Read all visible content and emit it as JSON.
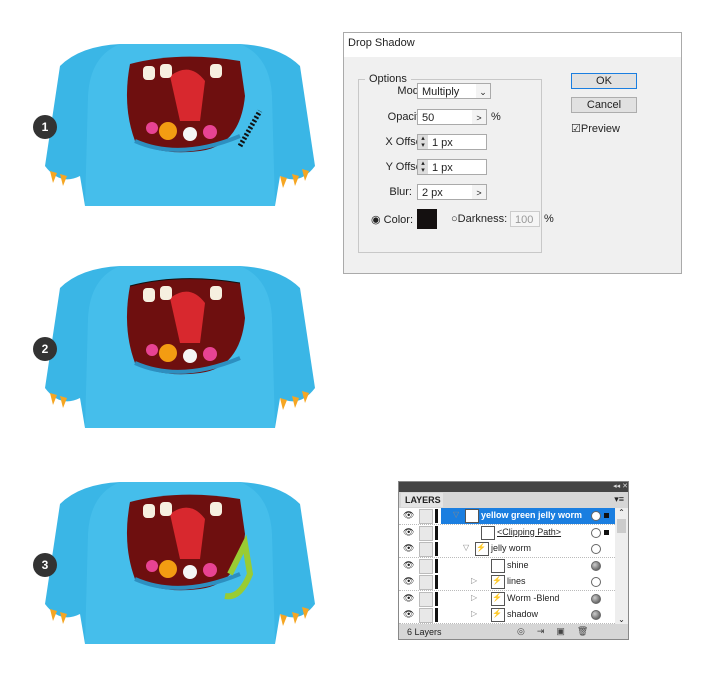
{
  "steps": [
    "1",
    "2",
    "3"
  ],
  "dialog": {
    "title": "Drop Shadow",
    "options_legend": "Options",
    "mode_label": "Mode:",
    "mode_value": "Multiply",
    "opacity_label": "Opacity:",
    "opacity_value": "50",
    "opacity_unit": "%",
    "x_offset_label": "X Offset:",
    "x_offset_value": "1 px",
    "y_offset_label": "Y Offset:",
    "y_offset_value": "1 px",
    "blur_label": "Blur:",
    "blur_value": "2 px",
    "color_label": "Color:",
    "color_selected": true,
    "color_swatch": "#141010",
    "darkness_label": "Darkness:",
    "darkness_value": "100",
    "darkness_unit": "%",
    "ok_label": "OK",
    "cancel_label": "Cancel",
    "preview_label": "Preview",
    "preview_checked": true
  },
  "layers_panel": {
    "tab": "LAYERS",
    "rows": [
      {
        "name": "yellow green jelly worm",
        "selected": true,
        "expanded": true
      },
      {
        "name": "<Clipping Path>",
        "underlined": true
      },
      {
        "name": "jelly worm",
        "expanded": true
      },
      {
        "name": "shine"
      },
      {
        "name": "lines"
      },
      {
        "name": "Worm -Blend"
      },
      {
        "name": "shadow"
      }
    ],
    "footer": "6 Layers"
  },
  "colors": {
    "monster": "#3ab6e6",
    "mouth": "#6e0f0f",
    "tongue": "#d8282e",
    "selection": "#1a7ee0"
  }
}
